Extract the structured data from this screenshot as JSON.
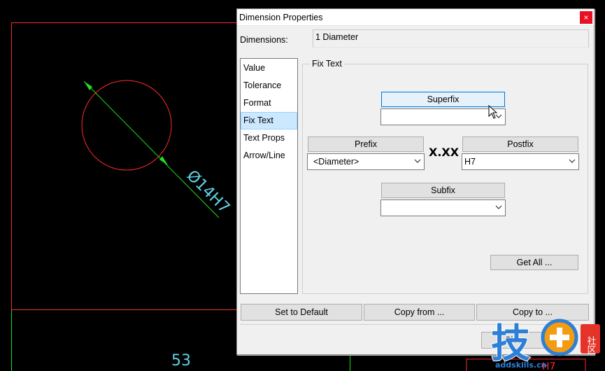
{
  "cad": {
    "dimension_text": "Ø14H7",
    "bottom_number": "53",
    "partial_label": "H7",
    "colors": {
      "outline": "#ff2a2a",
      "dimension": "#22dd22",
      "text": "#5fd3e6"
    }
  },
  "dialog": {
    "title": "Dimension Properties",
    "close_glyph": "×",
    "dimensions_label": "Dimensions:",
    "dimensions_value": "1 Diameter",
    "nav_items": [
      {
        "label": "Value",
        "selected": false
      },
      {
        "label": "Tolerance",
        "selected": false
      },
      {
        "label": "Format",
        "selected": false
      },
      {
        "label": "Fix Text",
        "selected": true
      },
      {
        "label": "Text Props",
        "selected": false
      },
      {
        "label": "Arrow/Line",
        "selected": false
      }
    ],
    "group_title": "Fix Text",
    "superfix": {
      "label": "Superfix",
      "value": ""
    },
    "prefix": {
      "label": "Prefix",
      "value": "<Diameter>"
    },
    "center_text": "X.XX",
    "postfix": {
      "label": "Postfix",
      "value": "H7"
    },
    "subfix": {
      "label": "Subfix",
      "value": ""
    },
    "get_all_label": "Get All ...",
    "set_default_label": "Set to Default",
    "copy_from_label": "Copy from ...",
    "copy_to_label": "Copy to ...",
    "close_label": "Close"
  },
  "watermark": {
    "brand": "技",
    "badge": "社区",
    "url": "addskills.cn"
  }
}
